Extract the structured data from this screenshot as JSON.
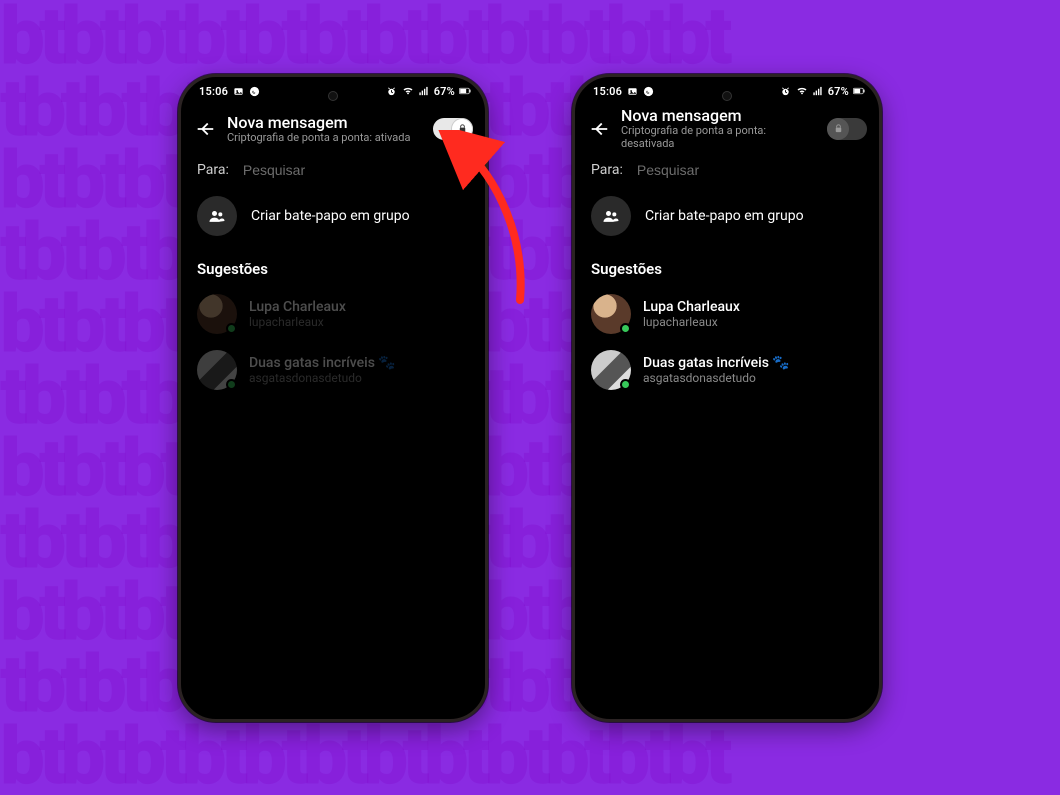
{
  "background": {
    "pattern_text": "btbtbtbtbtbtbtbtbtbtbtbt\ntbtbtbtbtbtbtbtbtbtbtbtb\nbtbtbtbtbtbtbtbtbtbtbtbt\ntbtbtbtbtbtbtbtbtbtbtbtb\nbtbtbtbtbtbtbtbtbtbtbtbt\ntbtbtbtbtbtbtbtbtbtbtbtb\nbtbtbtbtbtbtbtbtbtbtbtbt\ntbtbtbtbtbtbtbtbtbtbtbtb\nbtbtbtbtbtbtbtbtbtbtbtbt\ntbtbtbtbtbtbtbtbtbtbtbtb\nbtbtbtbtbtbtbtbtbtbtbtbt\ntbtbtbtbtbtbtbtbtbtbtbtb"
  },
  "statusbar": {
    "time": "15:06",
    "battery_pct": "67%"
  },
  "header": {
    "title": "Nova mensagem",
    "subtitle_on": "Criptografia de ponta a ponta: ativada",
    "subtitle_off": "Criptografia de ponta a ponta: desativada"
  },
  "to_row": {
    "label": "Para:",
    "placeholder": "Pesquisar"
  },
  "group_row": {
    "label": "Criar bate-papo em grupo"
  },
  "suggestions": {
    "title": "Sugestões",
    "contacts": [
      {
        "name": "Lupa Charleaux",
        "handle": "lupacharleaux",
        "avatar_variant": "a",
        "online": true
      },
      {
        "name": "Duas gatas incríveis 🐾",
        "handle": "asgatasdonasdetudo",
        "avatar_variant": "b",
        "online": true
      }
    ]
  },
  "annotation": {
    "arrow_color": "#ff2a1f"
  }
}
